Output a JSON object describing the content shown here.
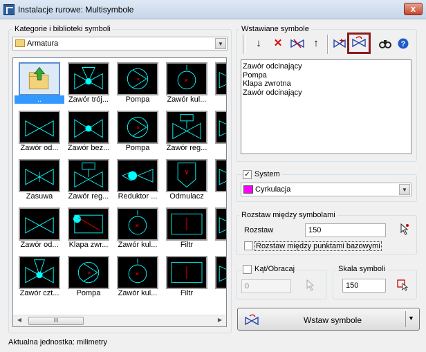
{
  "window": {
    "title": "Instalacje rurowe: Multisymbole",
    "close_label": "x"
  },
  "library": {
    "group_label": "Kategorie i biblioteki symboli",
    "combo_value": "Armatura",
    "items": [
      {
        "label": "..",
        "icon": "folder-up-icon"
      },
      {
        "label": "Zawór trój...",
        "icon": "three-way-valve-icon"
      },
      {
        "label": "Pompa",
        "icon": "pump-icon"
      },
      {
        "label": "Zawór kul...",
        "icon": "ball-valve-icon"
      },
      {
        "label": "Zaw",
        "icon": "valve-icon"
      },
      {
        "label": "Zawór od...",
        "icon": "shutoff-valve-icon"
      },
      {
        "label": "Zawór bez...",
        "icon": "safety-valve-icon"
      },
      {
        "label": "Pompa",
        "icon": "pump-icon"
      },
      {
        "label": "Zawór reg...",
        "icon": "control-valve-icon"
      },
      {
        "label": "Zaw",
        "icon": "valve-icon"
      },
      {
        "label": "Zasuwa",
        "icon": "gate-valve-icon"
      },
      {
        "label": "Zawór reg...",
        "icon": "control-valve-icon"
      },
      {
        "label": "Reduktor ...",
        "icon": "reducer-icon"
      },
      {
        "label": "Odmulacz",
        "icon": "desludger-icon"
      },
      {
        "label": "Prz",
        "icon": "valve-icon"
      },
      {
        "label": "Zawór od...",
        "icon": "shutoff-valve-icon"
      },
      {
        "label": "Klapa zwr...",
        "icon": "check-valve-icon"
      },
      {
        "label": "Zawór kul...",
        "icon": "ball-valve-icon"
      },
      {
        "label": "Filtr",
        "icon": "filter-icon"
      },
      {
        "label": "Od",
        "icon": "valve-icon"
      },
      {
        "label": "Zawór czt...",
        "icon": "four-way-valve-icon"
      },
      {
        "label": "Pompa",
        "icon": "pump-icon"
      },
      {
        "label": "Zawór kul...",
        "icon": "ball-valve-icon"
      },
      {
        "label": "Filtr",
        "icon": "filter-icon"
      },
      {
        "label": "Zaw",
        "icon": "valve-icon"
      }
    ],
    "scroll_grip": "III"
  },
  "inserted": {
    "group_label": "Wstawiane symbole",
    "toolbar": [
      "move-down-icon",
      "delete-icon",
      "replace-icon",
      "move-up-icon",
      "add-icon",
      "add-selected-icon",
      "find-icon",
      "help-icon"
    ],
    "items": [
      "Zawór odcinający",
      "Pompa",
      "Klapa zwrotna",
      "Zawór odcinający"
    ]
  },
  "system": {
    "label": "System",
    "checked": true,
    "value": "Cyrkulacja",
    "swatch_color": "#ff00ff"
  },
  "spacing": {
    "group_label": "Rozstaw między symbolami",
    "field_label": "Rozstaw",
    "value": "150",
    "base_points_label": "Rozstaw między punktami bazowymi",
    "base_points_checked": false
  },
  "angle": {
    "label": "Kąt/Obracaj",
    "checked": false,
    "value": "0"
  },
  "scale": {
    "group_label": "Skala symboli",
    "value": "150"
  },
  "insert_button": {
    "label": "Wstaw symbole"
  },
  "status": {
    "text": "Aktualna jednostka: milimetry"
  },
  "colors": {
    "symbol": "#00ffff",
    "accent_red": "#ff0000",
    "selection": "#3399ff"
  }
}
